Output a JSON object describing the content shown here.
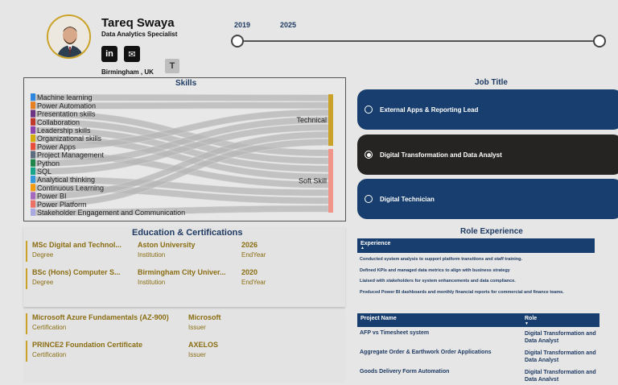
{
  "profile": {
    "name": "Tareq Swaya",
    "title": "Data Analytics Specialist",
    "location": "Birmingham , UK",
    "linkedin_icon": "in",
    "email_icon": "✉",
    "teams_icon": "T"
  },
  "slider": {
    "start_year": "2019",
    "end_year": "2025"
  },
  "skills": {
    "title": "Skills",
    "items": [
      {
        "label": "Machine learning",
        "color": "#2e86de",
        "target": "Technical"
      },
      {
        "label": "Power Automation",
        "color": "#e67e22",
        "target": "Technical"
      },
      {
        "label": "Presentation skills",
        "color": "#6c3483",
        "target": "Soft Skill"
      },
      {
        "label": "Collaboration",
        "color": "#c0392b",
        "target": "Soft Skill"
      },
      {
        "label": "Leadership skills",
        "color": "#8e44ad",
        "target": "Soft Skill"
      },
      {
        "label": "Organizational skills",
        "color": "#d4ac0d",
        "target": "Soft Skill"
      },
      {
        "label": "Power Apps",
        "color": "#e74c3c",
        "target": "Technical"
      },
      {
        "label": "Project Management",
        "color": "#5d6d7e",
        "target": "Soft Skill"
      },
      {
        "label": "Python",
        "color": "#1e8449",
        "target": "Technical"
      },
      {
        "label": "SQL",
        "color": "#17a589",
        "target": "Technical"
      },
      {
        "label": "Analytical thinking",
        "color": "#3498db",
        "target": "Soft Skill"
      },
      {
        "label": "Continuous Learning",
        "color": "#f39c12",
        "target": "Soft Skill"
      },
      {
        "label": "Power BI",
        "color": "#a569bd",
        "target": "Technical"
      },
      {
        "label": "Power Platform",
        "color": "#ec7063",
        "target": "Technical"
      },
      {
        "label": "Stakeholder Engagement and Communication",
        "color": "#a9a9e0",
        "target": "Soft Skill"
      }
    ],
    "targets": [
      {
        "label": "Technical",
        "color": "#c9a227"
      },
      {
        "label": "Soft Skill",
        "color": "#f1948a"
      }
    ]
  },
  "job_title": {
    "heading": "Job Title",
    "options": [
      {
        "label": "External Apps & Reporting Lead",
        "selected": false
      },
      {
        "label": "Digital Transformation and Data Analyst",
        "selected": true
      },
      {
        "label": "Digital Technician",
        "selected": false
      }
    ]
  },
  "education": {
    "heading": "Education  & Certifications",
    "rows": [
      {
        "degree": "MSc Digital and Technol...",
        "degree_label": "Degree",
        "institution": "Aston University",
        "institution_label": "Institution",
        "year": "2026",
        "year_label": "EndYear"
      },
      {
        "degree": "BSc (Hons) Computer S...",
        "degree_label": "Degree",
        "institution": "Birmingham City Univer...",
        "institution_label": "Institution",
        "year": "2020",
        "year_label": "EndYear"
      }
    ]
  },
  "certifications": [
    {
      "name": "Microsoft Azure Fundamentals (AZ-900)",
      "name_label": "Certification",
      "issuer": "Microsoft",
      "issuer_label": "Issuer"
    },
    {
      "name": "PRINCE2 Foundation Certificate",
      "name_label": "Certification",
      "issuer": "AXELOS",
      "issuer_label": "Issuer"
    }
  ],
  "role_experience": {
    "heading": "Role Experience",
    "column": "Experience",
    "lines": [
      "Conducted system analysis to support platform transitions and staff training.",
      "Defined KPIs and managed data metrics to align with business strategy",
      "Liaised with stakeholders for system enhancements and data compliance.",
      "Produced Power BI dashboards and monthly financial reports for commercial and finance teams."
    ]
  },
  "projects": {
    "col_name": "Project Name",
    "col_role": "Role",
    "rows": [
      {
        "name": "AFP vs Timesheet system",
        "role": "Digital Transformation and Data Analyst"
      },
      {
        "name": "Aggregate Order & Earthwork Order Applications",
        "role": "Digital Transformation and Data Analyst"
      },
      {
        "name": "Goods Delivery Form Automation",
        "role": "Digital Transformation and Data Analyst"
      }
    ]
  }
}
